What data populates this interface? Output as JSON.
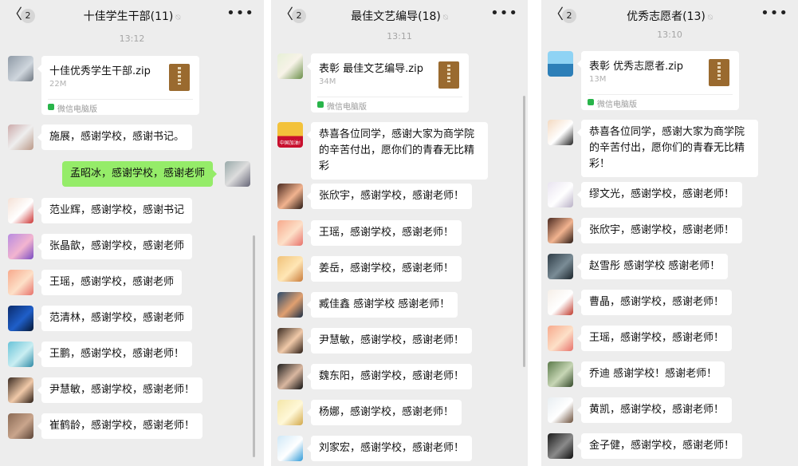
{
  "colors": {
    "panel_bg": "#ededed",
    "bubble_self": "#95ec69",
    "bubble_other": "#ffffff"
  },
  "icons": {
    "back": "chevron-left-icon",
    "mute": "bell-off-icon",
    "more": "more-horizontal-icon",
    "file": "zip-file-icon"
  },
  "panels": [
    {
      "header": {
        "back_symbol": "〈",
        "unread": "2",
        "title": "十佳学生干部(11)",
        "mute_symbol": "⍉",
        "more_symbol": "•••"
      },
      "time": "13:12",
      "file": {
        "name": "十佳优秀学生干部.zip",
        "size": "22M",
        "source": "微信电脑版"
      },
      "messages": [
        {
          "text": "施展，感谢学校，感谢书记。"
        },
        {
          "text": "孟昭冰，感谢学校，感谢老师"
        },
        {
          "text": "范业辉，感谢学校，感谢书记"
        },
        {
          "text": "张晶歆，感谢学校，感谢老师"
        },
        {
          "text": "王瑶，感谢学校，感谢老师"
        },
        {
          "text": "范清林，感谢学校，感谢老师"
        },
        {
          "text": "王鹏，感谢学校，感谢老师！"
        },
        {
          "text": "尹慧敏，感谢学校，感谢老师！"
        },
        {
          "text": "崔鹤龄，感谢学校，感谢老师！"
        }
      ]
    },
    {
      "header": {
        "back_symbol": "〈",
        "unread": "2",
        "title": "最佳文艺编导(18)",
        "mute_symbol": "⍉",
        "more_symbol": "•••"
      },
      "time": "13:11",
      "file": {
        "name": "表彰 最佳文艺编导.zip",
        "size": "34M",
        "source": "微信电脑版"
      },
      "avatar_text": "中国加油!",
      "messages": [
        {
          "text": "恭喜各位同学，感谢大家为商学院的辛苦付出，愿你们的青春无比精彩"
        },
        {
          "text": "张欣宇，感谢学校，感谢老师！"
        },
        {
          "text": "王瑶，感谢学校，感谢老师！"
        },
        {
          "text": "姜岳，感谢学校，感谢老师！"
        },
        {
          "text": "臧佳鑫 感谢学校 感谢老师！"
        },
        {
          "text": "尹慧敏，感谢学校，感谢老师！"
        },
        {
          "text": "魏东阳，感谢学校，感谢老师！"
        },
        {
          "text": "杨娜，感谢学校，感谢老师！"
        },
        {
          "text": "刘家宏，感谢学校，感谢老师！"
        }
      ]
    },
    {
      "header": {
        "back_symbol": "〈",
        "unread": "2",
        "title": "优秀志愿者(13)",
        "mute_symbol": "⍉",
        "more_symbol": "•••"
      },
      "time": "13:10",
      "file": {
        "name": "表彰 优秀志愿者.zip",
        "size": "13M",
        "source": "微信电脑版"
      },
      "messages": [
        {
          "text": "恭喜各位同学，感谢大家为商学院的辛苦付出，愿你们的青春无比精彩！"
        },
        {
          "text": "缪文光，感谢学校，感谢老师！"
        },
        {
          "text": "张欣宇，感谢学校，感谢老师！"
        },
        {
          "text": "赵雪彤 感谢学校 感谢老师！"
        },
        {
          "text": "曹晶，感谢学校，感谢老师！"
        },
        {
          "text": "王瑶，感谢学校，感谢老师！"
        },
        {
          "text": "乔迪 感谢学校！感谢老师！"
        },
        {
          "text": "黄凯，感谢学校，感谢老师！"
        },
        {
          "text": "金子健，感谢学校，感谢老师！"
        }
      ]
    }
  ]
}
